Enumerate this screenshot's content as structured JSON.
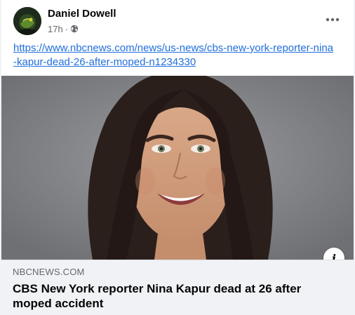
{
  "post": {
    "author": "Daniel Dowell",
    "time": "17h",
    "separator": "·",
    "privacy_icon": "globe-icon",
    "more_icon": "more-horizontal-icon",
    "link_text": "https://www.nbcnews.com/news/us-news/cbs-new-york-reporter-nina-kapur-dead-26-after-moped-n1234330"
  },
  "link_preview": {
    "domain": "NBCNEWS.COM",
    "headline": "CBS New York reporter Nina Kapur dead at 26 after moped accident",
    "info_label": "i",
    "info_icon": "info-icon"
  },
  "colors": {
    "link": "#216fdb",
    "card_bg": "#ffffff",
    "footer_bg": "#f0f2f5",
    "secondary_text": "#65676b",
    "primary_text": "#050505"
  }
}
